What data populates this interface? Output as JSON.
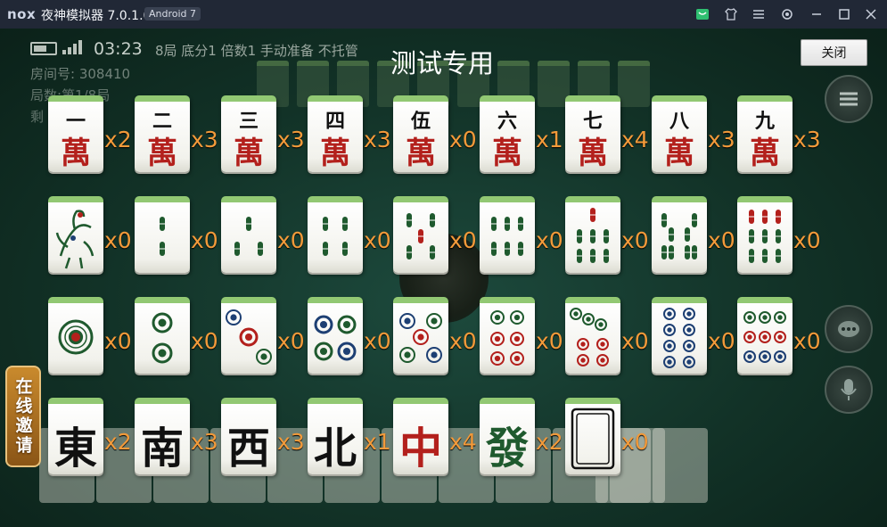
{
  "window": {
    "logo": "nox",
    "title": "夜神模拟器 7.0.1.0",
    "android_badge": "Android 7",
    "icons": [
      "store-icon",
      "shirt-icon",
      "menu-icon",
      "gear-icon",
      "minimize-icon",
      "maximize-icon",
      "close-icon"
    ]
  },
  "game": {
    "clock": "03:23",
    "status": "8局  底分1  倍数1  手动准备  不托管",
    "room": "房间号: 308410",
    "round": "局数:第1/8局",
    "remaining": "剩",
    "title": "测试专用",
    "close_button": "关闭",
    "invite_button": "在线邀请"
  },
  "wan_numbers": [
    "一",
    "二",
    "三",
    "四",
    "伍",
    "六",
    "七",
    "八",
    "九"
  ],
  "wan_suffix": "萬",
  "counts": {
    "wan": [
      "x2",
      "x3",
      "x3",
      "x3",
      "x0",
      "x1",
      "x4",
      "x3",
      "x3"
    ],
    "bamboo": [
      "x0",
      "x0",
      "x0",
      "x0",
      "x0",
      "x0",
      "x0",
      "x0",
      "x0"
    ],
    "dots": [
      "x0",
      "x0",
      "x0",
      "x0",
      "x0",
      "x0",
      "x0",
      "x0",
      "x0"
    ],
    "honors": [
      "x2",
      "x3",
      "x3",
      "x1",
      "x4",
      "x2",
      "x0"
    ]
  },
  "honors": [
    "東",
    "南",
    "西",
    "北",
    "中",
    "發",
    ""
  ],
  "colors": {
    "count": "#f29a3a",
    "tile_top": "#92c873",
    "red": "#b3201c",
    "green": "#1f5a2e",
    "blue": "#1d3f73"
  }
}
